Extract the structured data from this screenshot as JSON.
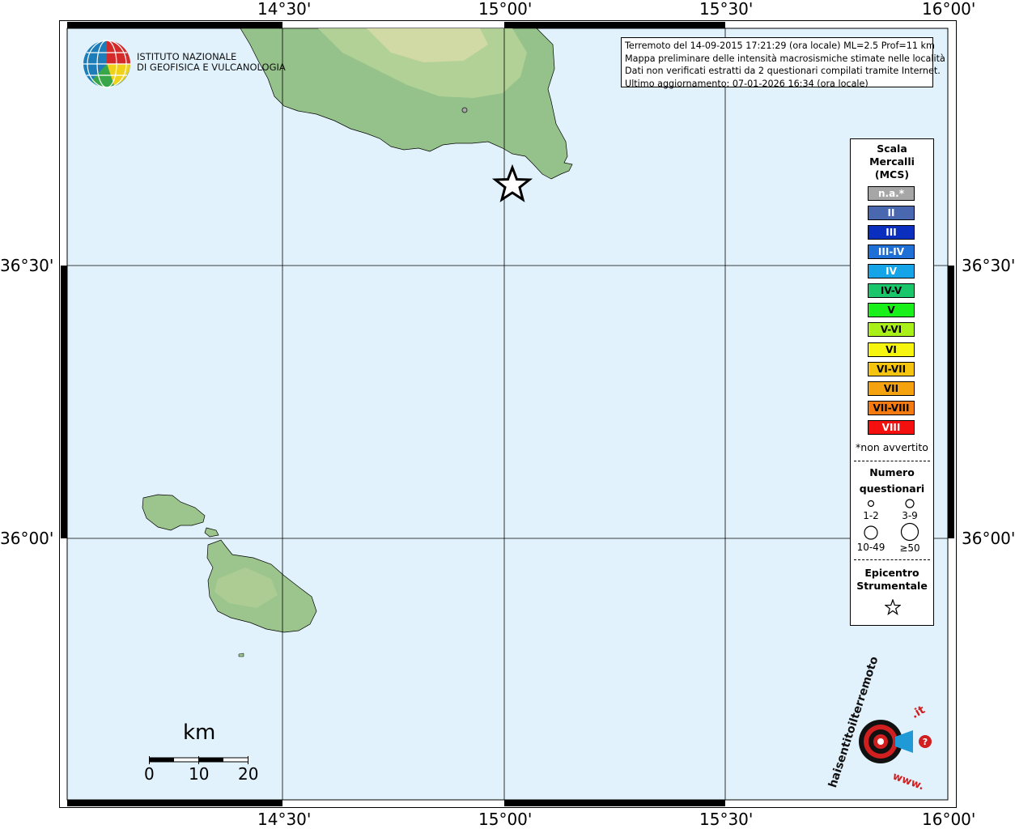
{
  "map": {
    "top_labels": [
      "14°30'",
      "15°00'",
      "15°30'",
      "16°00'"
    ],
    "bottom_labels": [
      "14°30'",
      "15°00'",
      "15°30'",
      "16°00'"
    ],
    "left_labels": [
      "36°30'",
      "36°00'"
    ],
    "right_labels": [
      "36°30'",
      "36°00'"
    ],
    "sea_color": "#e1f2fd",
    "land_color": "#8dbe85"
  },
  "institute": {
    "name_line1": "ISTITUTO NAZIONALE",
    "name_line2": "DI GEOFISICA E VULCANOLOGIA"
  },
  "info": {
    "line1": "Terremoto del 14-09-2015 17:21:29 (ora locale) ML=2.5 Prof=11 km",
    "line2": "Mappa preliminare delle intensità macrosismiche stimate nelle località",
    "line3": "Dati non verificati estratti da 2 questionari compilati tramite Internet.",
    "line4": "Ultimo aggiornamento: 07-01-2026 16:34 (ora locale)"
  },
  "legend": {
    "scale_title_1": "Scala",
    "scale_title_2": "Mercalli",
    "scale_title_3": "(MCS)",
    "classes": [
      {
        "label": "n.a.*",
        "color": "#a6a6a6",
        "text": "#ffffff"
      },
      {
        "label": "II",
        "color": "#4a68b0",
        "text": "#ffffff"
      },
      {
        "label": "III",
        "color": "#0a2fbf",
        "text": "#ffffff"
      },
      {
        "label": "III-IV",
        "color": "#1e6fd6",
        "text": "#ffffff"
      },
      {
        "label": "IV",
        "color": "#16a4e8",
        "text": "#ffffff"
      },
      {
        "label": "IV-V",
        "color": "#19c76a",
        "text": "#000000"
      },
      {
        "label": "V",
        "color": "#19f019",
        "text": "#000000"
      },
      {
        "label": "V-VI",
        "color": "#a8f018",
        "text": "#000000"
      },
      {
        "label": "VI",
        "color": "#f5f50f",
        "text": "#000000"
      },
      {
        "label": "VI-VII",
        "color": "#f5c40f",
        "text": "#000000"
      },
      {
        "label": "VII",
        "color": "#f5a20f",
        "text": "#000000"
      },
      {
        "label": "VII-VIII",
        "color": "#f57a0f",
        "text": "#000000"
      },
      {
        "label": "VIII",
        "color": "#f51010",
        "text": "#ffffff"
      }
    ],
    "non_avvertito": "*non avvertito",
    "count_title_1": "Numero",
    "count_title_2": "questionari",
    "count_classes": [
      "1-2",
      "3-9",
      "10-49",
      "≥50"
    ],
    "epicenter_title_1": "Epicentro",
    "epicenter_title_2": "Strumentale"
  },
  "scale_bar": {
    "unit": "km",
    "ticks": [
      "0",
      "10",
      "20"
    ]
  },
  "brand": {
    "text_main": "haisentitoilterremoto",
    "text_ext": ".it",
    "prefix": "www."
  }
}
